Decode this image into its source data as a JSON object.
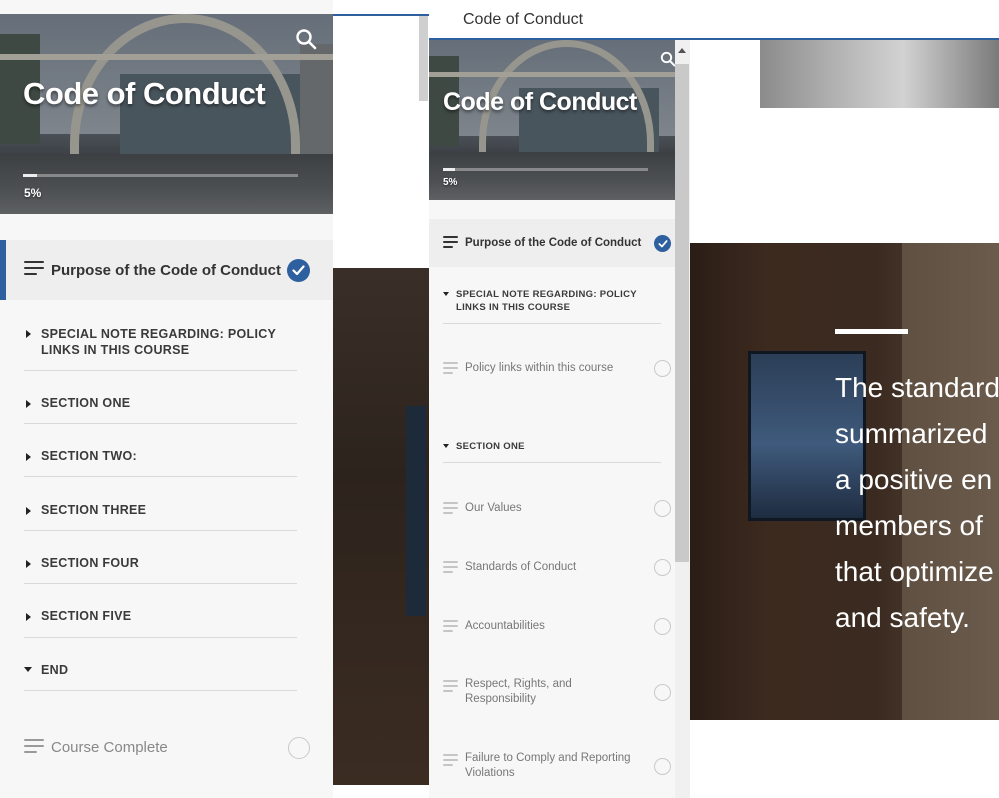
{
  "course": {
    "title": "Code of Conduct",
    "progress_text": "5%",
    "progress_value": 0.05
  },
  "left_panel": {
    "current_lesson": "Purpose of the Code of Conduct",
    "sections": [
      {
        "label": "SPECIAL NOTE REGARDING: POLICY",
        "label2": "LINKS IN THIS COURSE",
        "expanded": false
      },
      {
        "label": "SECTION ONE",
        "expanded": false
      },
      {
        "label": "SECTION TWO:",
        "expanded": false
      },
      {
        "label": "SECTION THREE",
        "expanded": false
      },
      {
        "label": "SECTION FOUR",
        "expanded": false
      },
      {
        "label": "SECTION FIVE",
        "expanded": false
      },
      {
        "label": "END",
        "expanded": true
      }
    ],
    "final_lesson": "Course Complete"
  },
  "right_panel": {
    "top_bar_title": "Code of Conduct",
    "sidebar": {
      "current_lesson": "Purpose of the Code of Conduct",
      "section_special_line1": "SPECIAL NOTE REGARDING: POLICY",
      "section_special_line2": "LINKS IN THIS COURSE",
      "lesson_policy_links": "Policy links within this course",
      "section_one": "SECTION ONE",
      "lessons": [
        {
          "line1": "Our Values"
        },
        {
          "line1": "Standards of Conduct"
        },
        {
          "line1": "Accountabilities"
        },
        {
          "line1": "Respect, Rights, and",
          "line2": "Responsibility"
        },
        {
          "line1": "Failure to Comply and Reporting",
          "line2": "Violations"
        }
      ]
    },
    "content": {
      "quote_lines": [
        "The standard",
        "summarized",
        "a positive en",
        "members of",
        "that optimize",
        "and safety."
      ]
    }
  },
  "colors": {
    "accent_blue": "#2e5f9f",
    "sidebar_bg": "#f7f7f8"
  },
  "icons": {
    "search": "search-icon",
    "check": "check-circle-icon",
    "lesson": "lesson-lines-icon"
  }
}
